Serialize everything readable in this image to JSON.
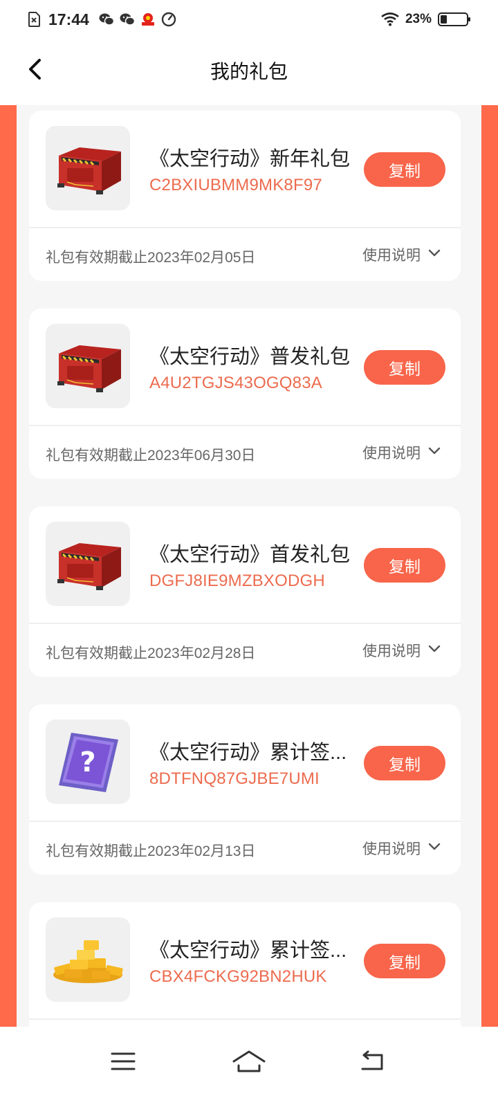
{
  "status_bar": {
    "time": "17:44",
    "battery": "23%",
    "icons": [
      "sim-error-icon",
      "wechat-icon",
      "wechat-icon",
      "app-notification-icon",
      "speed-icon",
      "wifi-icon",
      "battery-icon"
    ]
  },
  "header": {
    "title": "我的礼包",
    "back_icon": "chevron-left-icon"
  },
  "colors": {
    "accent": "#f8654a",
    "code": "#ec6b4e",
    "side_strip": "#ff6a4a"
  },
  "gifts": [
    {
      "title": "《太空行动》新年礼包",
      "code": "C2BXIUBMM9MK8F97",
      "copy_label": "复制",
      "expiry": "礼包有效期截止2023年02月05日",
      "usage_label": "使用说明",
      "image": "red-crate"
    },
    {
      "title": "《太空行动》普发礼包",
      "code": "A4U2TGJS43OGQ83A",
      "copy_label": "复制",
      "expiry": "礼包有效期截止2023年06月30日",
      "usage_label": "使用说明",
      "image": "red-crate"
    },
    {
      "title": "《太空行动》首发礼包",
      "code": "DGFJ8IE9MZBXODGH",
      "copy_label": "复制",
      "expiry": "礼包有效期截止2023年02月28日",
      "usage_label": "使用说明",
      "image": "red-crate"
    },
    {
      "title": "《太空行动》累计签...",
      "code": "8DTFNQ87GJBE7UMI",
      "copy_label": "复制",
      "expiry": "礼包有效期截止2023年02月13日",
      "usage_label": "使用说明",
      "image": "mystery-card"
    },
    {
      "title": "《太空行动》累计签...",
      "code": "CBX4FCKG92BN2HUK",
      "copy_label": "复制",
      "image": "gold-pile"
    }
  ],
  "nav": [
    "menu-icon",
    "home-icon",
    "back-icon"
  ]
}
